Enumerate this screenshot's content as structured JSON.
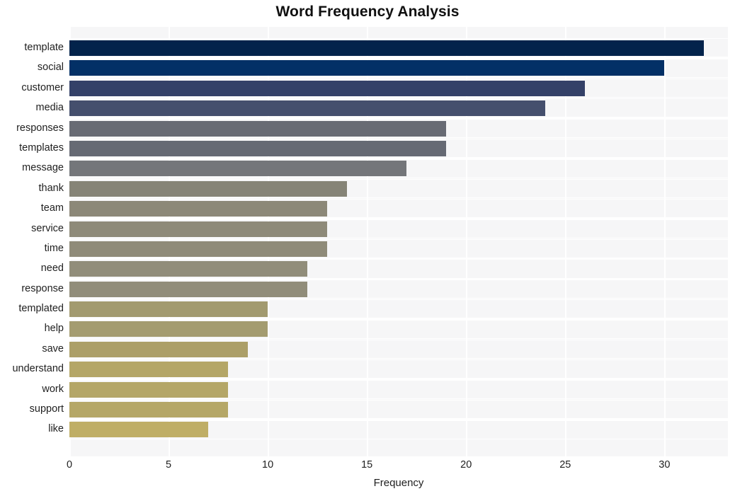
{
  "chart_data": {
    "type": "bar",
    "orientation": "horizontal",
    "title": "Word Frequency Analysis",
    "xlabel": "Frequency",
    "ylabel": "",
    "categories": [
      "template",
      "social",
      "customer",
      "media",
      "responses",
      "templates",
      "message",
      "thank",
      "team",
      "service",
      "time",
      "need",
      "response",
      "templated",
      "help",
      "save",
      "understand",
      "work",
      "support",
      "like"
    ],
    "values": [
      32,
      30,
      26,
      24,
      19,
      19,
      17,
      14,
      13,
      13,
      13,
      12,
      12,
      10,
      10,
      9,
      8,
      8,
      8,
      7
    ],
    "bar_colors": [
      "#03234b",
      "#033066",
      "#344168",
      "#454f6d",
      "#686b74",
      "#666a74",
      "#74767a",
      "#868477",
      "#8c8878",
      "#8e8a79",
      "#8f8b79",
      "#918d7a",
      "#918d7a",
      "#a29a6f",
      "#a49c70",
      "#ac9f68",
      "#b4a667",
      "#b4a667",
      "#b5a767",
      "#bfae66"
    ],
    "xticks": [
      0,
      5,
      10,
      15,
      20,
      25,
      30
    ],
    "xtick_labels": [
      "0",
      "5",
      "10",
      "15",
      "20",
      "25",
      "30"
    ],
    "xlim": [
      0,
      33.2
    ],
    "grid": true,
    "grid_color": "#ffffff",
    "plot_background": "#f6f6f7",
    "figure_background": "#ffffff",
    "legend": null
  }
}
